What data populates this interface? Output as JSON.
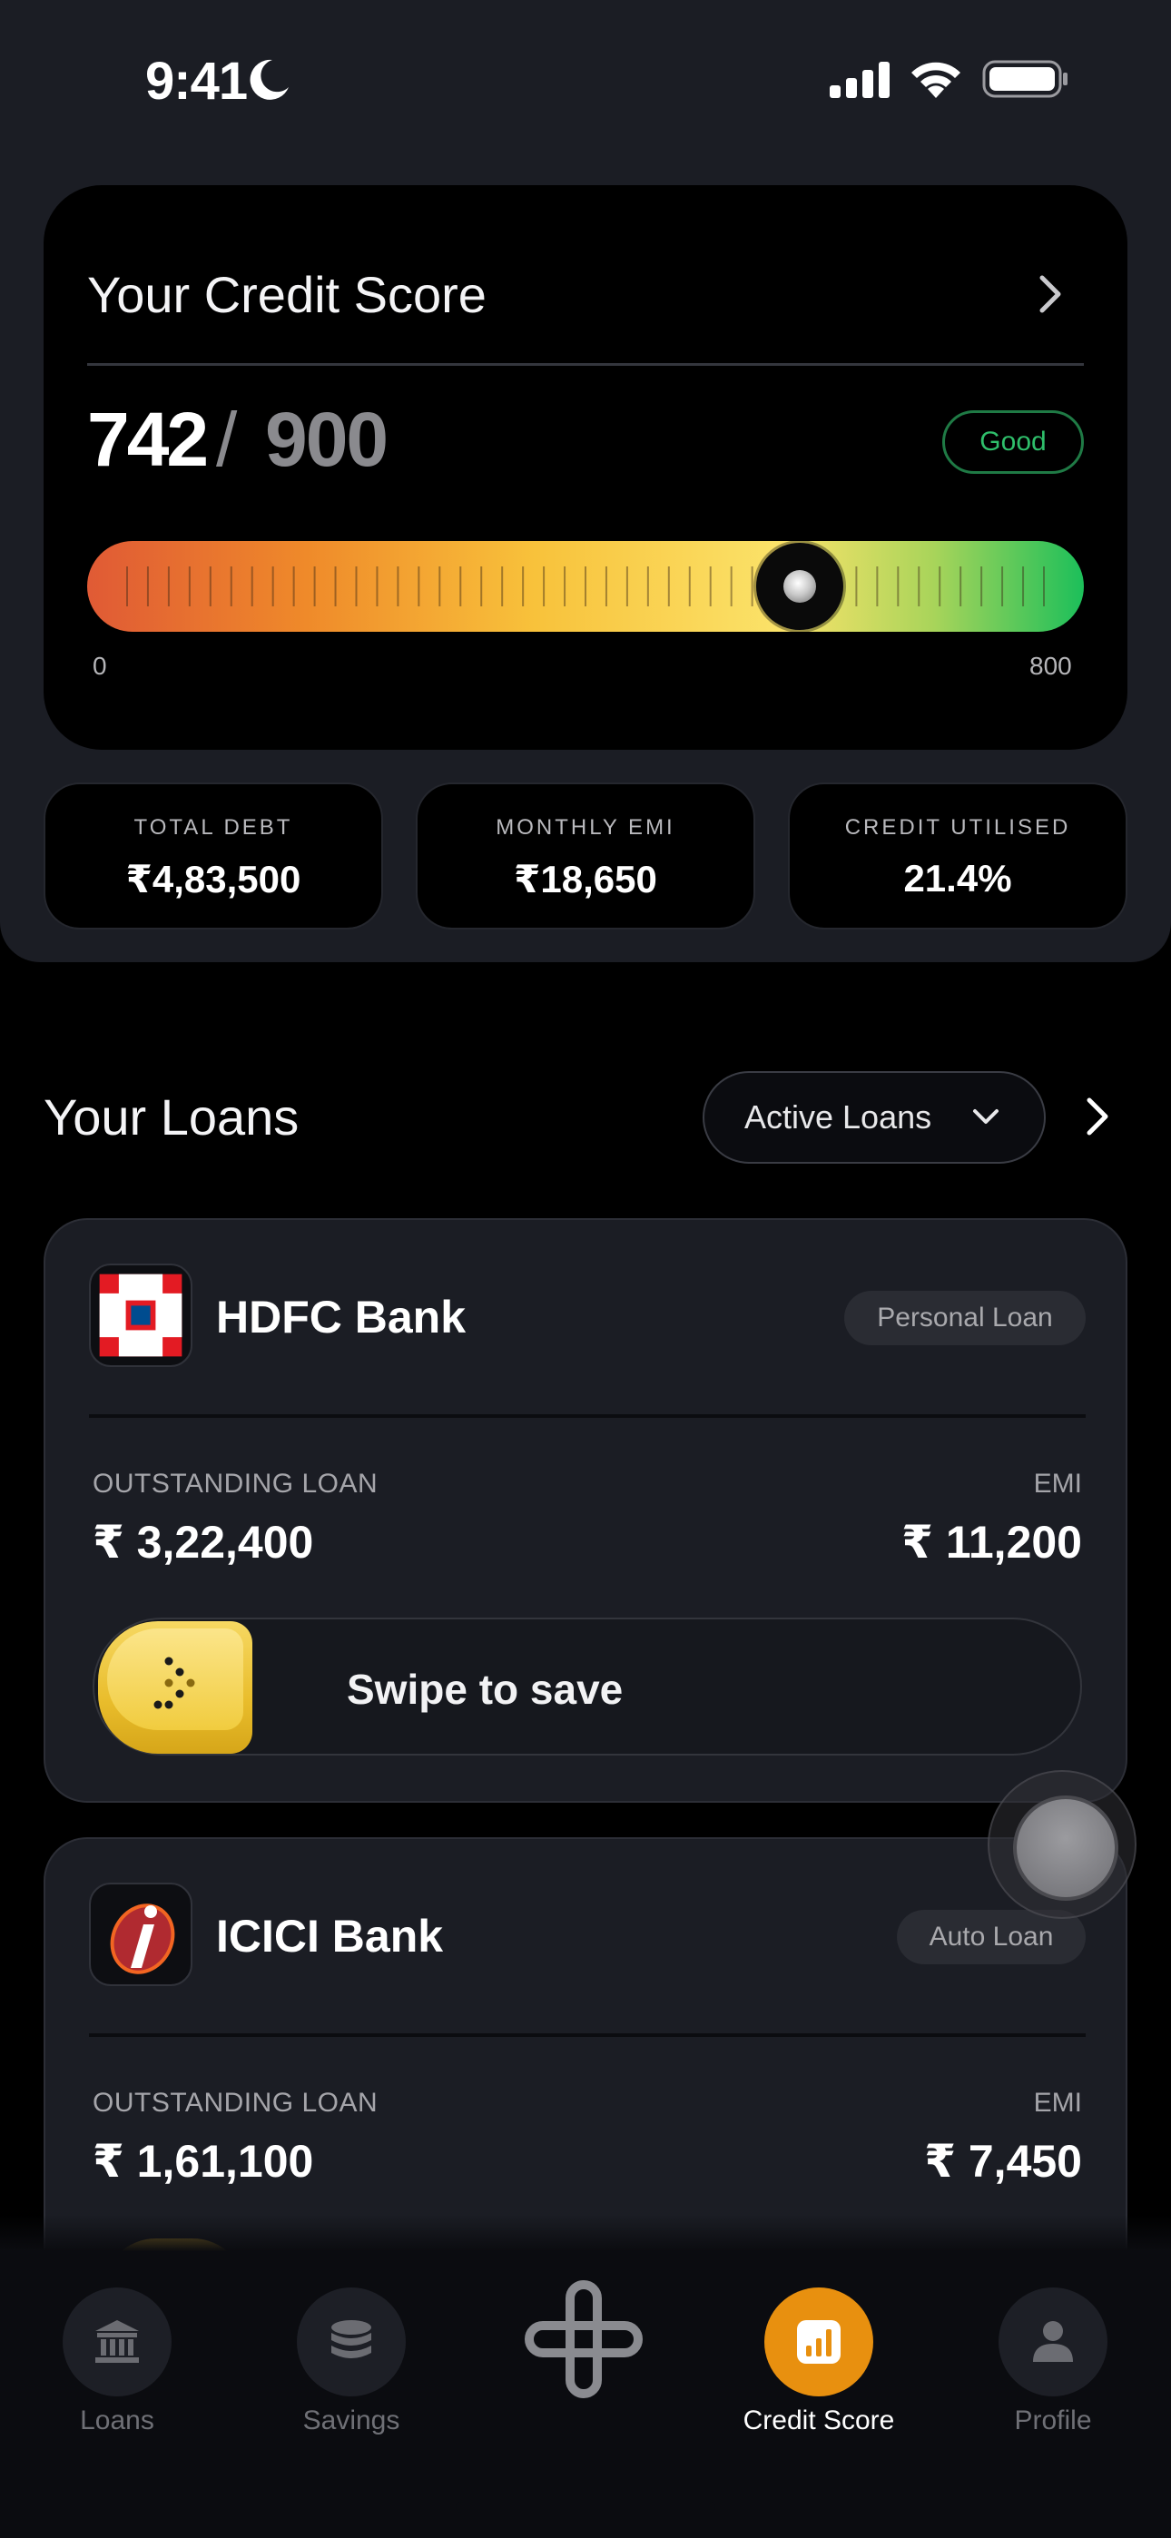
{
  "status_bar": {
    "time": "9:41"
  },
  "credit_score": {
    "title": "Your Credit Score",
    "score": "742",
    "separator": "/",
    "max": "900",
    "rating": "Good",
    "gauge_min": "0",
    "gauge_max": "800",
    "gauge_position": 0.715
  },
  "stats": [
    {
      "label": "TOTAL DEBT",
      "value": "₹4,83,500"
    },
    {
      "label": "MONTHLY EMI",
      "value": "₹18,650"
    },
    {
      "label": "CREDIT UTILISED",
      "value": "21.4%"
    }
  ],
  "loans": {
    "title": "Your Loans",
    "filter": "Active Loans",
    "items": [
      {
        "bank": "HDFC Bank",
        "type": "Personal Loan",
        "outstanding_label": "OUTSTANDING LOAN",
        "outstanding": "₹ 3,22,400",
        "emi_label": "EMI",
        "emi": "₹ 11,200",
        "swipe_label": "Swipe to save"
      },
      {
        "bank": "ICICI Bank",
        "type": "Auto Loan",
        "outstanding_label": "OUTSTANDING LOAN",
        "outstanding": "₹ 1,61,100",
        "emi_label": "EMI",
        "emi": "₹ 7,450"
      }
    ]
  },
  "nav": {
    "items": [
      {
        "label": "Loans",
        "icon": "bank-icon"
      },
      {
        "label": "Savings",
        "icon": "coins-icon"
      },
      {
        "label": "",
        "icon": "app-logo-icon"
      },
      {
        "label": "Credit Score",
        "icon": "chart-icon",
        "active": true
      },
      {
        "label": "Profile",
        "icon": "person-icon"
      }
    ]
  },
  "colors": {
    "accent": "#e8900f",
    "good": "#2fbf6b",
    "card": "#1b1d24",
    "background": "#000000"
  }
}
